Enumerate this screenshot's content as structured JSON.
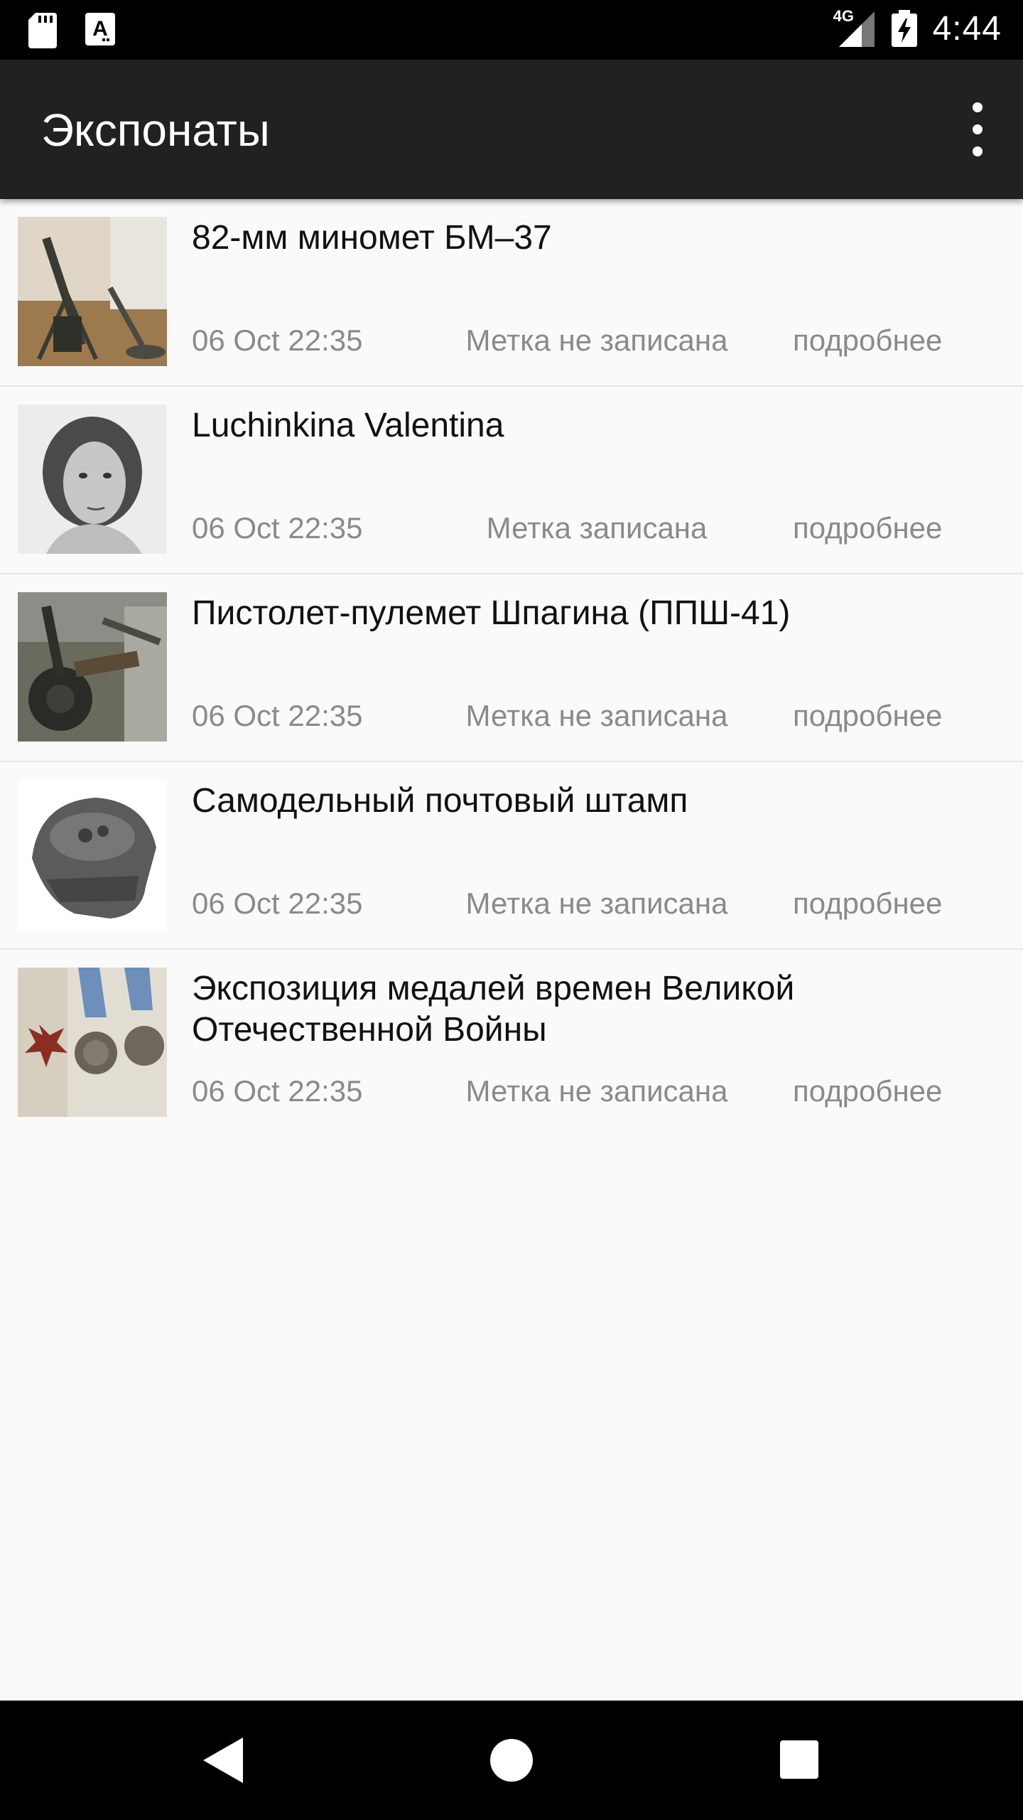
{
  "status_bar": {
    "network": "4G",
    "time": "4:44"
  },
  "app_bar": {
    "title": "Экспонаты"
  },
  "exhibits": [
    {
      "title": "82-мм миномет БМ–37",
      "date": "06 Oct 22:35",
      "status": "Метка не записана",
      "more": "подробнее",
      "thumb_icon": "mortar-photo"
    },
    {
      "title": "Luchinkina Valentina",
      "date": "06 Oct 22:35",
      "status": "Метка записана",
      "more": "подробнее",
      "thumb_icon": "portrait-photo"
    },
    {
      "title": "Пистолет-пулемет Шпагина (ППШ-41)",
      "date": "06 Oct 22:35",
      "status": "Метка не записана",
      "more": "подробнее",
      "thumb_icon": "ppsh-photo"
    },
    {
      "title": "Самодельный почтовый штамп",
      "date": "06 Oct 22:35",
      "status": "Метка не записана",
      "more": "подробнее",
      "thumb_icon": "stamp-photo"
    },
    {
      "title": "Экспозиция медалей времен Великой Отечественной Войны",
      "date": "06 Oct 22:35",
      "status": "Метка не записана",
      "more": "подробнее",
      "thumb_icon": "medals-photo"
    }
  ],
  "colors": {
    "app_bar": "#212121",
    "background": "#fafafa",
    "meta_text": "#8a8a8a"
  }
}
